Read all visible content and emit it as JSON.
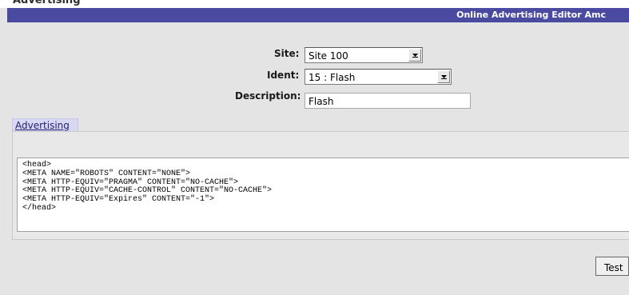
{
  "header": {
    "top_text": "Advertising",
    "title": "Online Advertising Editor Amc"
  },
  "form": {
    "site_label": "Site:",
    "site_value": "Site 100",
    "ident_label": "Ident:",
    "ident_value": "15 : Flash",
    "description_label": "Description:",
    "description_value": "Flash"
  },
  "tabs": [
    {
      "label": "Advertising",
      "active": true
    }
  ],
  "code": {
    "lines": [
      "<head>",
      "<META NAME=\"ROBOTS\" CONTENT=\"NONE\">",
      "<META HTTP-EQUIV=\"PRAGMA\" CONTENT=\"NO-CACHE\">",
      "<META HTTP-EQUIV=\"CACHE-CONTROL\" CONTENT=\"NO-CACHE\">",
      "<META HTTP-EQUIV=\"Expires\" CONTENT=\"-1\">",
      "</head>"
    ]
  },
  "actions": {
    "test_label": "Test"
  },
  "colors": {
    "titlebar": "#4a4aa0",
    "background": "#e4e4e4",
    "tab": "#d8d8f4"
  }
}
